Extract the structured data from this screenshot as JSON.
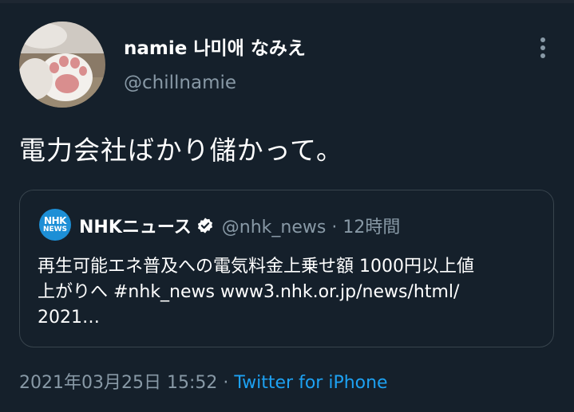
{
  "tweet": {
    "author": {
      "display_name": "namie 나미애 なみえ",
      "handle": "@chillnamie",
      "avatar_icon": "cat-paw-avatar"
    },
    "more_icon": "more-vertical-icon",
    "text": "電力会社ばかり儲かって。",
    "quoted": {
      "avatar_top": "NHK",
      "avatar_bottom": "NEWS",
      "name": "NHKニュース",
      "verified_icon": "verified-badge-icon",
      "meta": "@nhk_news · 12時間",
      "body_lines": [
        "再生可能エネ普及への電気料金上乗せ額 1000円以上値",
        "上がりへ #nhk_news www3.nhk.or.jp/news/html/",
        "2021…"
      ]
    },
    "timestamp": "2021年03月25日 15:52",
    "separator": " · ",
    "source": "Twitter for iPhone"
  },
  "colors": {
    "background": "#15202b",
    "text": "#ffffff",
    "secondary": "#8899a6",
    "link": "#1da1f2",
    "border": "#38444d",
    "nhk_blue": "#1d8fd6"
  }
}
